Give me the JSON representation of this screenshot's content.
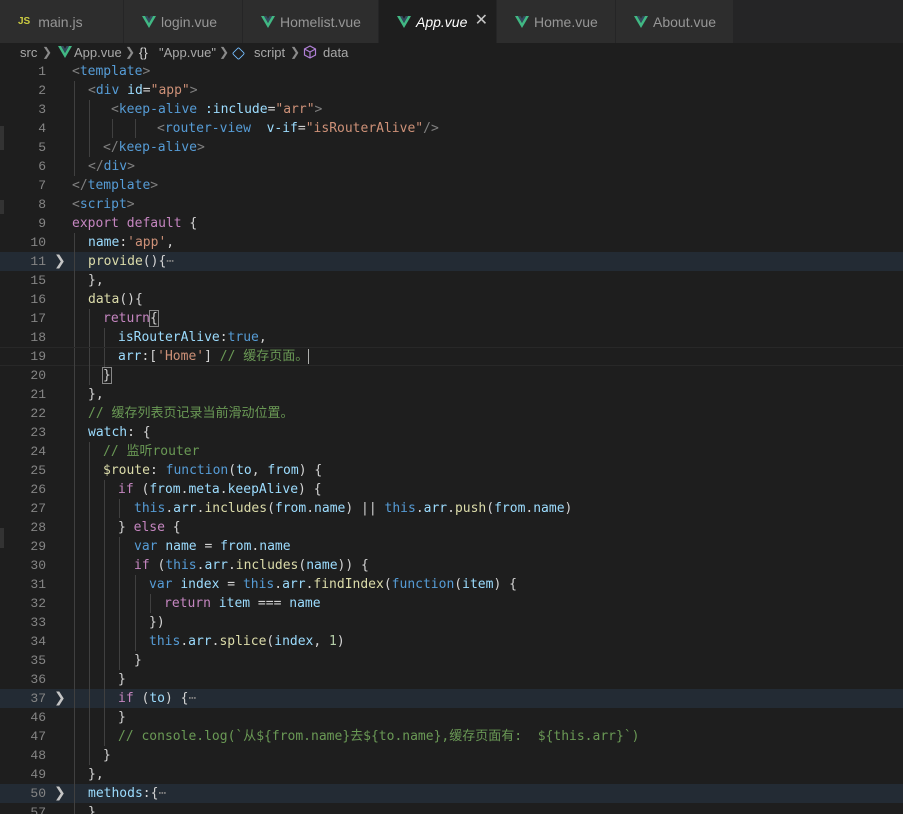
{
  "tabs": [
    {
      "label": "main.js",
      "icon": "js-file-icon",
      "active": false
    },
    {
      "label": "login.vue",
      "icon": "vue-file-icon",
      "active": false
    },
    {
      "label": "Homelist.vue",
      "icon": "vue-file-icon",
      "active": false
    },
    {
      "label": "App.vue",
      "icon": "vue-file-icon",
      "active": true,
      "close": "✕"
    },
    {
      "label": "Home.vue",
      "icon": "vue-file-icon",
      "active": false
    },
    {
      "label": "About.vue",
      "icon": "vue-file-icon",
      "active": false
    }
  ],
  "js_badge": "JS",
  "breadcrumb": {
    "folder": "src",
    "file": "App.vue",
    "object": "\"App.vue\"",
    "object_symbol": "{}",
    "section": "script",
    "member": "data"
  },
  "line_numbers": [
    "1",
    "2",
    "3",
    "4",
    "5",
    "6",
    "7",
    "8",
    "9",
    "10",
    "11",
    "15",
    "16",
    "17",
    "18",
    "19",
    "20",
    "21",
    "22",
    "23",
    "24",
    "25",
    "26",
    "27",
    "28",
    "29",
    "30",
    "31",
    "32",
    "33",
    "34",
    "35",
    "36",
    "37",
    "46",
    "47",
    "48",
    "49",
    "50",
    "57"
  ],
  "folded_marker": "⋯",
  "code": {
    "l1": [
      "<",
      "template",
      ">"
    ],
    "l2": [
      "<",
      "div",
      "id",
      "=",
      "\"app\"",
      ">"
    ],
    "l3": [
      "<",
      "keep-alive",
      ":include",
      "=",
      "\"arr\"",
      ">"
    ],
    "l4": [
      "<",
      "router-view",
      "v-if",
      "=",
      "\"isRouterAlive\"",
      "/>"
    ],
    "l5": [
      "</",
      "keep-alive",
      ">"
    ],
    "l6": [
      "</",
      "div",
      ">"
    ],
    "l7": [
      "</",
      "template",
      ">"
    ],
    "l8": [
      "<",
      "script",
      ">"
    ],
    "l9": [
      "export",
      "default",
      "{"
    ],
    "l10": [
      "name",
      ":",
      "'app'",
      ","
    ],
    "l11": [
      "provide",
      "(){"
    ],
    "l15": [
      "},"
    ],
    "l16": [
      "data",
      "(){"
    ],
    "l17": [
      "return",
      "{"
    ],
    "l18": [
      "isRouterAlive",
      ":",
      "true",
      ","
    ],
    "l19": [
      "arr",
      ":[",
      "'Home'",
      "]",
      "// 缓存页面。"
    ],
    "l20": [
      "}"
    ],
    "l21": [
      "},"
    ],
    "l22": [
      "// 缓存列表页记录当前滑动位置。"
    ],
    "l23": [
      "watch",
      ": {"
    ],
    "l24": [
      "// 监听router"
    ],
    "l25": [
      "$route",
      ": ",
      "function",
      "(",
      "to",
      ", ",
      "from",
      ") {"
    ],
    "l26": [
      "if",
      " (",
      "from",
      ".",
      "meta",
      ".",
      "keepAlive",
      ") {"
    ],
    "l27": [
      "this",
      ".",
      "arr",
      ".",
      "includes",
      "(",
      "from",
      ".",
      "name",
      ") || ",
      "this",
      ".",
      "arr",
      ".",
      "push",
      "(",
      "from",
      ".",
      "name",
      ")"
    ],
    "l28": [
      "} ",
      "else",
      " {"
    ],
    "l29": [
      "var",
      "name",
      " = ",
      "from",
      ".",
      "name"
    ],
    "l30": [
      "if",
      " (",
      "this",
      ".",
      "arr",
      ".",
      "includes",
      "(",
      "name",
      ")) {"
    ],
    "l31": [
      "var",
      "index",
      " = ",
      "this",
      ".",
      "arr",
      ".",
      "findIndex",
      "(",
      "function",
      "(",
      "item",
      ") {"
    ],
    "l32": [
      "return",
      "item",
      " === ",
      "name"
    ],
    "l33": [
      "})"
    ],
    "l34": [
      "this",
      ".",
      "arr",
      ".",
      "splice",
      "(",
      "index",
      ", ",
      "1",
      ")"
    ],
    "l35": [
      "}"
    ],
    "l36": [
      "}"
    ],
    "l37": [
      "if",
      " (",
      "to",
      ") {"
    ],
    "l46": [
      "}"
    ],
    "l47": [
      "// console.log(`从${from.name}去${to.name},缓存页面有:  ${this.arr}`)"
    ],
    "l48": [
      "}"
    ],
    "l49": [
      "},"
    ],
    "l50": [
      "methods",
      ":{"
    ],
    "l57": [
      "},"
    ]
  },
  "colors": {
    "background": "#1e1e1e",
    "tag": "#569cd6",
    "attribute": "#9cdcfe",
    "string": "#ce9178",
    "comment": "#6a9955",
    "function": "#dcdcaa",
    "control_keyword": "#c586c0",
    "vue_green": "#41b883"
  }
}
